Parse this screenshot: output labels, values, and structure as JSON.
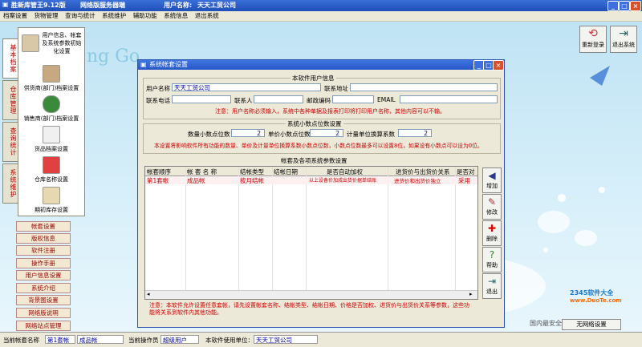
{
  "app": {
    "title": "胜新库管王9.12版",
    "server_label": "网络版服务器端",
    "user_label": "用户名称:",
    "user_name": "天天工贸公司"
  },
  "menu": [
    "档案设置",
    "货物管理",
    "查询与统计",
    "系统维护",
    "辅助功能",
    "系统信息",
    "退出系统"
  ],
  "left_tabs": [
    {
      "label": "基本档案",
      "icon": "folder-icon"
    },
    {
      "label": "仓库管理",
      "icon": "warehouse-icon"
    },
    {
      "label": "查询统计",
      "icon": "chart-icon"
    },
    {
      "label": "系统维护",
      "icon": "tools-icon"
    }
  ],
  "left_panel_items": [
    {
      "label": "用户信息、帐套及系统参数初始化设置",
      "icon": "users-icon"
    },
    {
      "label": "供货商(部门)档案设置",
      "icon": "supplier-icon"
    },
    {
      "label": "销售商(部门)档案设置",
      "icon": "globe-icon"
    },
    {
      "label": "货品档案设置",
      "icon": "goods-icon"
    },
    {
      "label": "仓库名称设置",
      "icon": "warehouse-icon"
    },
    {
      "label": "期初库存设置",
      "icon": "ledger-icon"
    }
  ],
  "left_buttons": [
    "帐套设置",
    "版权信息",
    "软件注册",
    "操作手册",
    "用户信息设置",
    "系统介绍",
    "背景图设置",
    "网络版说明",
    "网络站点管理"
  ],
  "top_buttons": [
    {
      "label": "重新登录",
      "icon": "relogin-icon"
    },
    {
      "label": "退出系统",
      "icon": "exit-icon"
    }
  ],
  "watermark": {
    "line1": "2345软件大全",
    "line2": "www.DuoTe.com",
    "line3": "国内最安全的软件站",
    "line4": "无网络设置"
  },
  "dialog": {
    "title": "系统帐套设置",
    "user_info": {
      "legend": "本软件用户信息",
      "user_name_label": "用户名称",
      "user_name_value": "天天工贸公司",
      "address_label": "联系地址",
      "address_value": "",
      "phone_label": "联系电话",
      "phone_value": "",
      "contact_label": "联系人",
      "contact_value": "",
      "zip_label": "邮政编码",
      "zip_value": "",
      "email_label": "EMAIL",
      "email_value": "",
      "note": "注意：用户名称必须输入，系统中各种单据及报表打印将打印用户名称，其他内容可以不输。"
    },
    "decimal": {
      "legend": "系统小数点位数设置",
      "qty_label": "数量小数点位数",
      "qty_value": "2",
      "price_label": "单价小数点位数",
      "price_value": "2",
      "unit_label": "计量单位换算系数",
      "unit_value": "2",
      "note": "本设置将影响软件所有功能的数量、单价及计量单位换算系数小数点位数，小数点位数最多可以设置8位，如果设有小数点可以设为0位。"
    },
    "accounts": {
      "legend": "帐套及各项系统参数设置",
      "columns": [
        "帐套顺序",
        "帐 套 名 称",
        "结帐类型",
        "结帐日期",
        "是否自动加权",
        "进货价与出货价关系",
        "是否对"
      ],
      "rows": [
        [
          "第1套帐",
          "成品帐",
          "按月结帐",
          "",
          "以上设备价加成出货价据单结账",
          "进货价和出货价独立",
          "采用"
        ]
      ]
    },
    "side_buttons": [
      {
        "label": "增加",
        "icon": "add-icon"
      },
      {
        "label": "修改",
        "icon": "edit-icon"
      },
      {
        "label": "删除",
        "icon": "delete-icon"
      },
      {
        "label": "帮助",
        "icon": "help-icon"
      },
      {
        "label": "退出",
        "icon": "exit-icon"
      }
    ],
    "bottom_note": "注意：本软件允许设置任意套帐，请先设置帐套名称、结帐类型、结帐日期、价格是否加权、进货价与出货价关系等参数，这些功能将关系到软件内其他功能。"
  },
  "status": {
    "account_label": "当前帐套名称",
    "account_value": "第1套帐",
    "account_name": "成品帐",
    "operator_label": "当前操作员",
    "operator_value": "超级用户",
    "unit_label": "本软件使用单位：",
    "unit_value": "天天工贸公司"
  },
  "colors": {
    "title_bar": "#2856c8",
    "note_red": "#cc0000",
    "desktop": "#bfe3f4"
  }
}
